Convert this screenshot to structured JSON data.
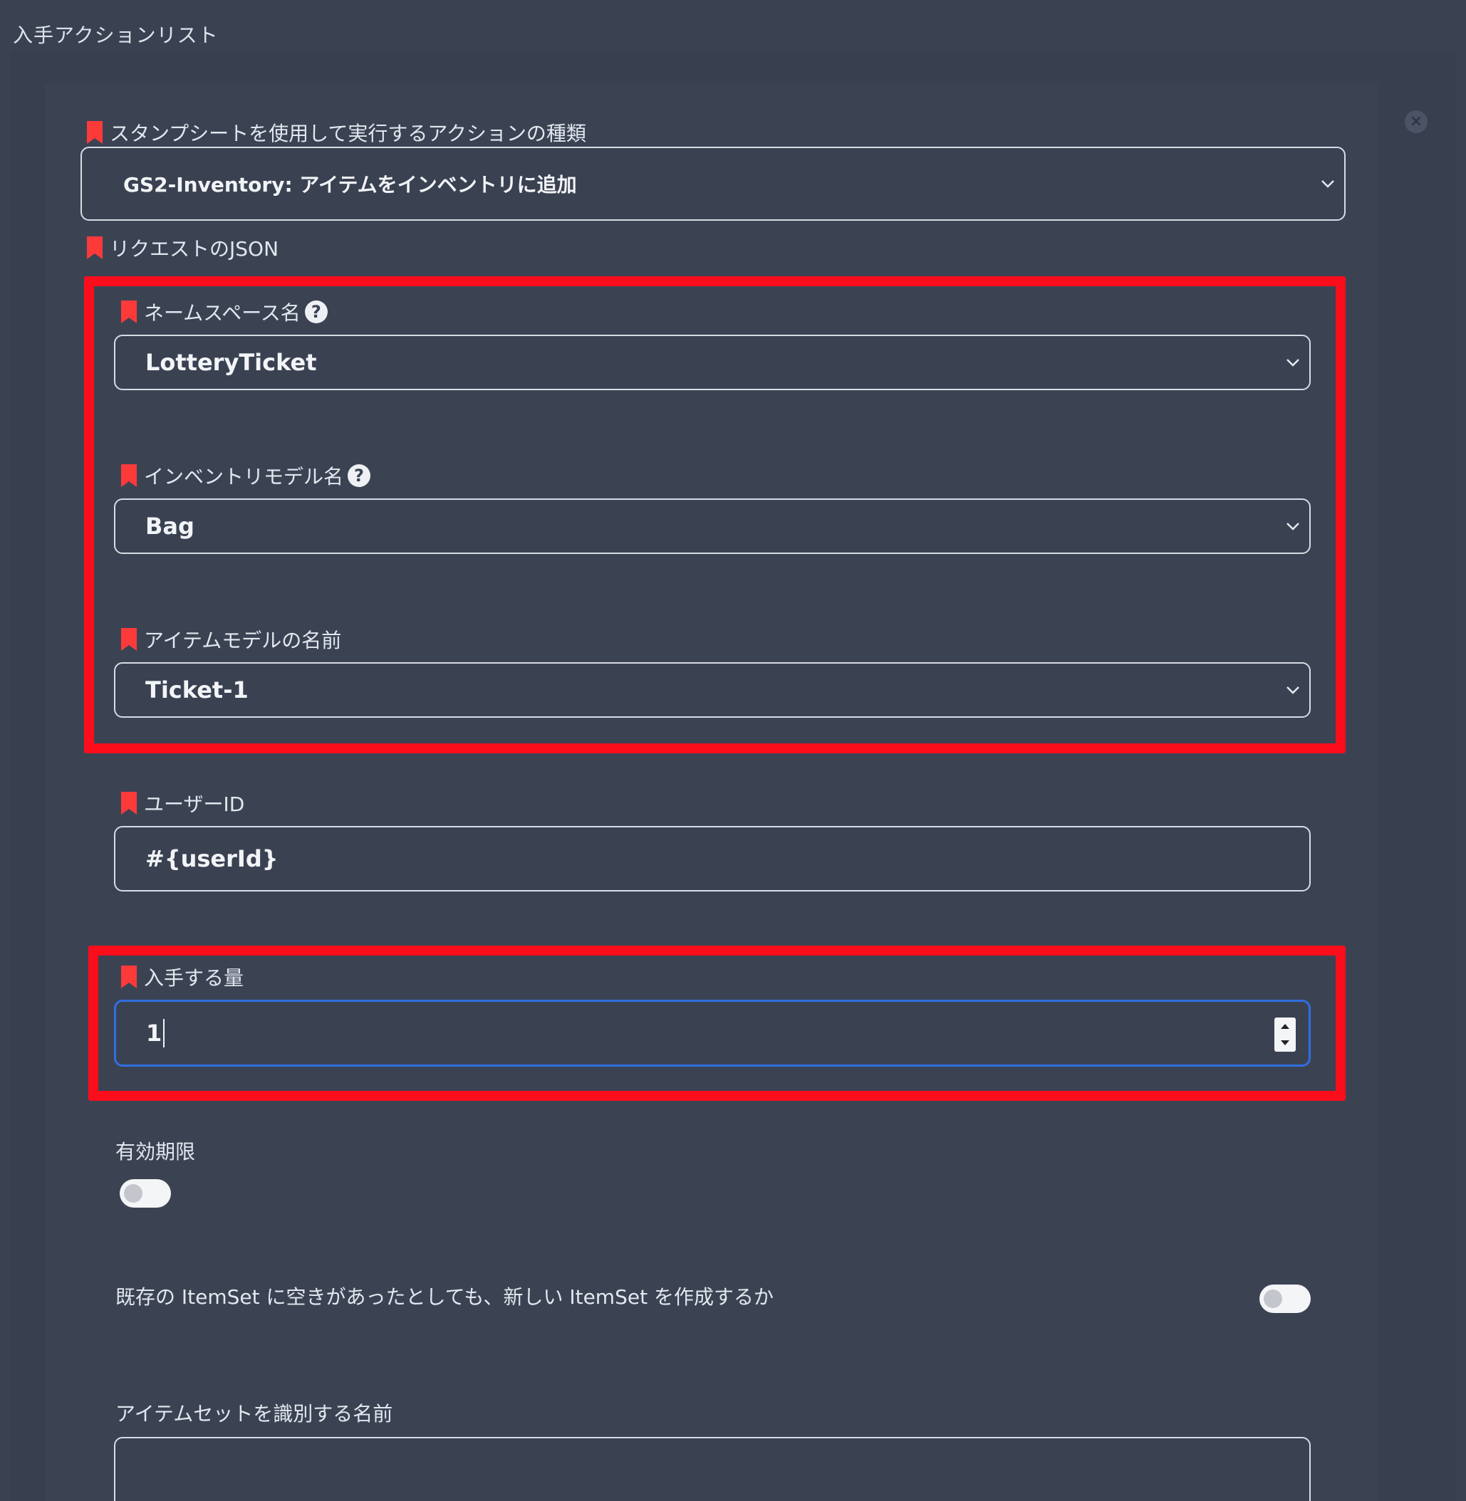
{
  "header": {
    "title": "入手アクションリスト"
  },
  "dialog": {
    "close_icon": "close-circle-icon"
  },
  "action_type": {
    "label": "スタンプシートを使用して実行するアクションの種類",
    "value": "GS2-Inventory: アイテムをインベントリに追加"
  },
  "request_json": {
    "label": "リクエストのJSON"
  },
  "namespace": {
    "label": "ネームスペース名",
    "value": "LotteryTicket"
  },
  "inventory_model": {
    "label": "インベントリモデル名",
    "value": "Bag"
  },
  "item_model": {
    "label": "アイテムモデルの名前",
    "value": "Ticket-1"
  },
  "user_id": {
    "label": "ユーザーID",
    "value": "#{userId}"
  },
  "acquire_count": {
    "label": "入手する量",
    "value": "1"
  },
  "expires": {
    "label": "有効期限",
    "enabled": false
  },
  "create_new_item_set": {
    "label": "既存の ItemSet に空きがあったとしても、新しい ItemSet を作成するか",
    "enabled": false
  },
  "item_set_name": {
    "label": "アイテムセットを識別する名前",
    "value": ""
  },
  "colors": {
    "background": "#3a4252",
    "required_marker": "#fc3a3a",
    "highlight_frame": "#fc0d1b",
    "focus_border": "#2f6fe0"
  }
}
